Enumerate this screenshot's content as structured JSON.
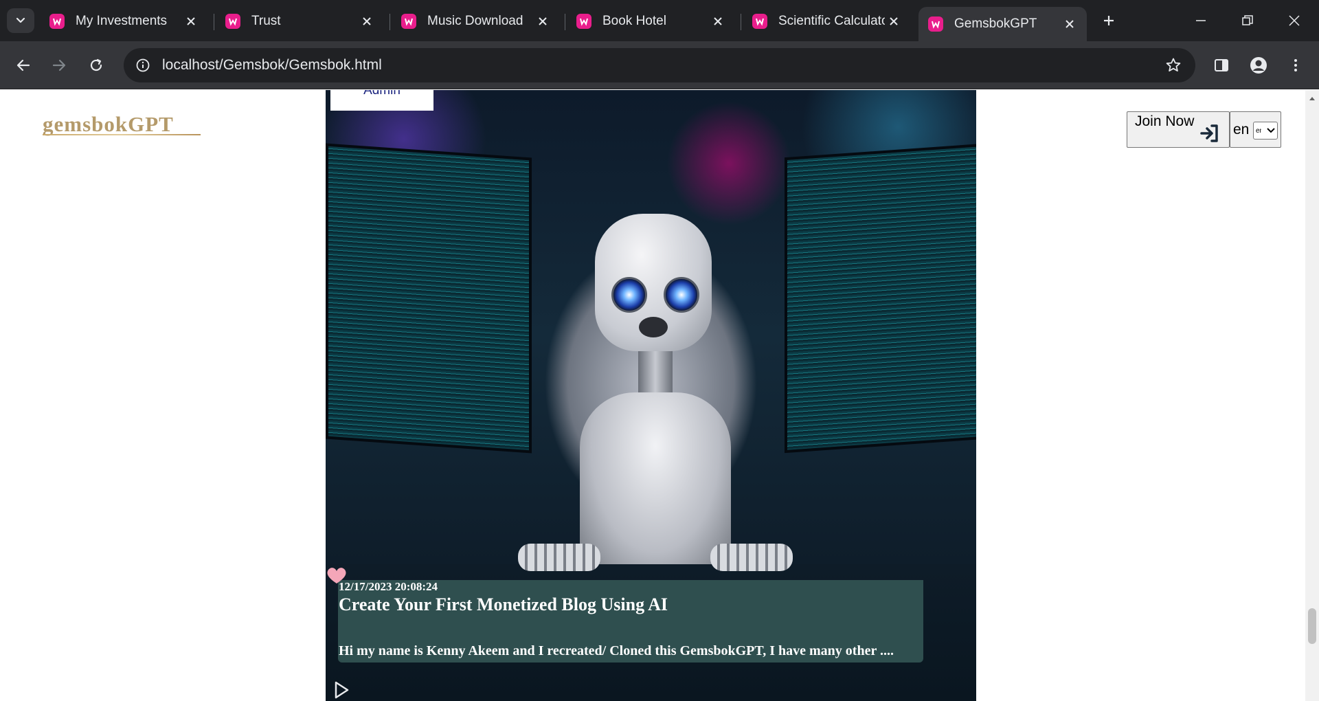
{
  "browser": {
    "tabs": [
      {
        "title": "My Investments",
        "active": false
      },
      {
        "title": "Trust",
        "active": false
      },
      {
        "title": "Music Download",
        "active": false
      },
      {
        "title": "Book Hotel",
        "active": false
      },
      {
        "title": "Scientific Calculator",
        "active": false
      },
      {
        "title": "GemsbokGPT",
        "active": true
      }
    ],
    "url": "localhost/Gemsbok/Gemsbok.html",
    "tab_favicon_color": "#e91e8c"
  },
  "page": {
    "logo_text": "gemsbokGPT",
    "admin_label": "Admin",
    "join_label": "Join Now",
    "lang_label": "en",
    "lang_selected": "en",
    "post": {
      "date": "12/17/2023 20:08:24",
      "title": "Create Your First Monetized Blog Using AI",
      "excerpt": "Hi my name is Kenny Akeem and I recreated/ Cloned this GemsbokGPT, I have many other ...."
    },
    "colors": {
      "card_bg": "#2f4f4f",
      "logo_gold": "#b49a6a",
      "admin_text": "#1a237e"
    }
  }
}
